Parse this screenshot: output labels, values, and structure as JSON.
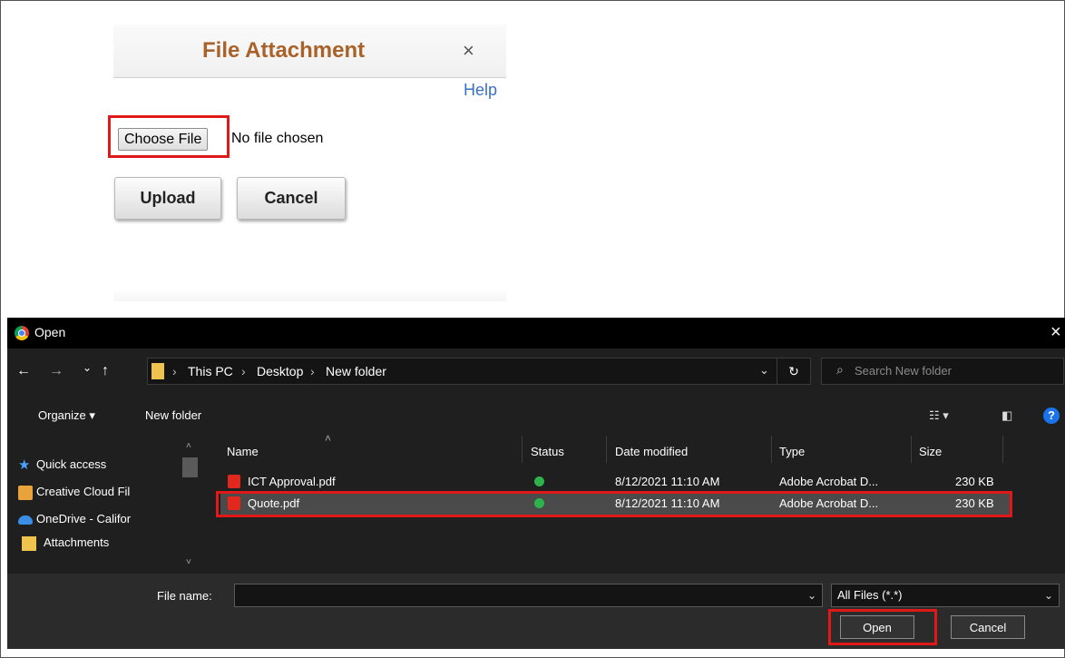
{
  "file_attachment": {
    "title": "File Attachment",
    "close_glyph": "×",
    "help_link": "Help",
    "choose_file_label": "Choose File",
    "no_file_text": "No file chosen",
    "upload_label": "Upload",
    "cancel_label": "Cancel"
  },
  "open_dialog": {
    "title": "Open",
    "close_glyph": "×",
    "nav": {
      "back": "←",
      "forward": "→",
      "recent": "⌄",
      "up": "↑"
    },
    "breadcrumb": [
      "This PC",
      "Desktop",
      "New folder"
    ],
    "breadcrumb_sep": "›",
    "refresh_glyph": "↻",
    "search_placeholder": "Search New folder",
    "toolbar": {
      "organize": "Organize ▾",
      "new_folder": "New folder"
    },
    "sidebar": [
      {
        "label": "Quick access",
        "icon": "star-icon"
      },
      {
        "label": "Creative Cloud Fil",
        "icon": "creative-cloud-icon"
      },
      {
        "label": "OneDrive - Califor",
        "icon": "onedrive-icon"
      },
      {
        "label": "Attachments",
        "icon": "folder-icon"
      }
    ],
    "columns": [
      "Name",
      "Status",
      "Date modified",
      "Type",
      "Size"
    ],
    "files": [
      {
        "name": "ICT Approval.pdf",
        "date": "8/12/2021 11:10 AM",
        "type": "Adobe Acrobat D...",
        "size": "230 KB",
        "selected": false
      },
      {
        "name": "Quote.pdf",
        "date": "8/12/2021 11:10 AM",
        "type": "Adobe Acrobat D...",
        "size": "230 KB",
        "selected": true
      }
    ],
    "file_name_label": "File name:",
    "file_name_value": "",
    "file_type": "All Files (*.*)",
    "open_label": "Open",
    "cancel_label": "Cancel"
  },
  "colors": {
    "highlight": "#e01818",
    "title_brown": "#a8622a",
    "link_blue": "#3a6fc8",
    "dark_bg": "#1f1f1f"
  }
}
